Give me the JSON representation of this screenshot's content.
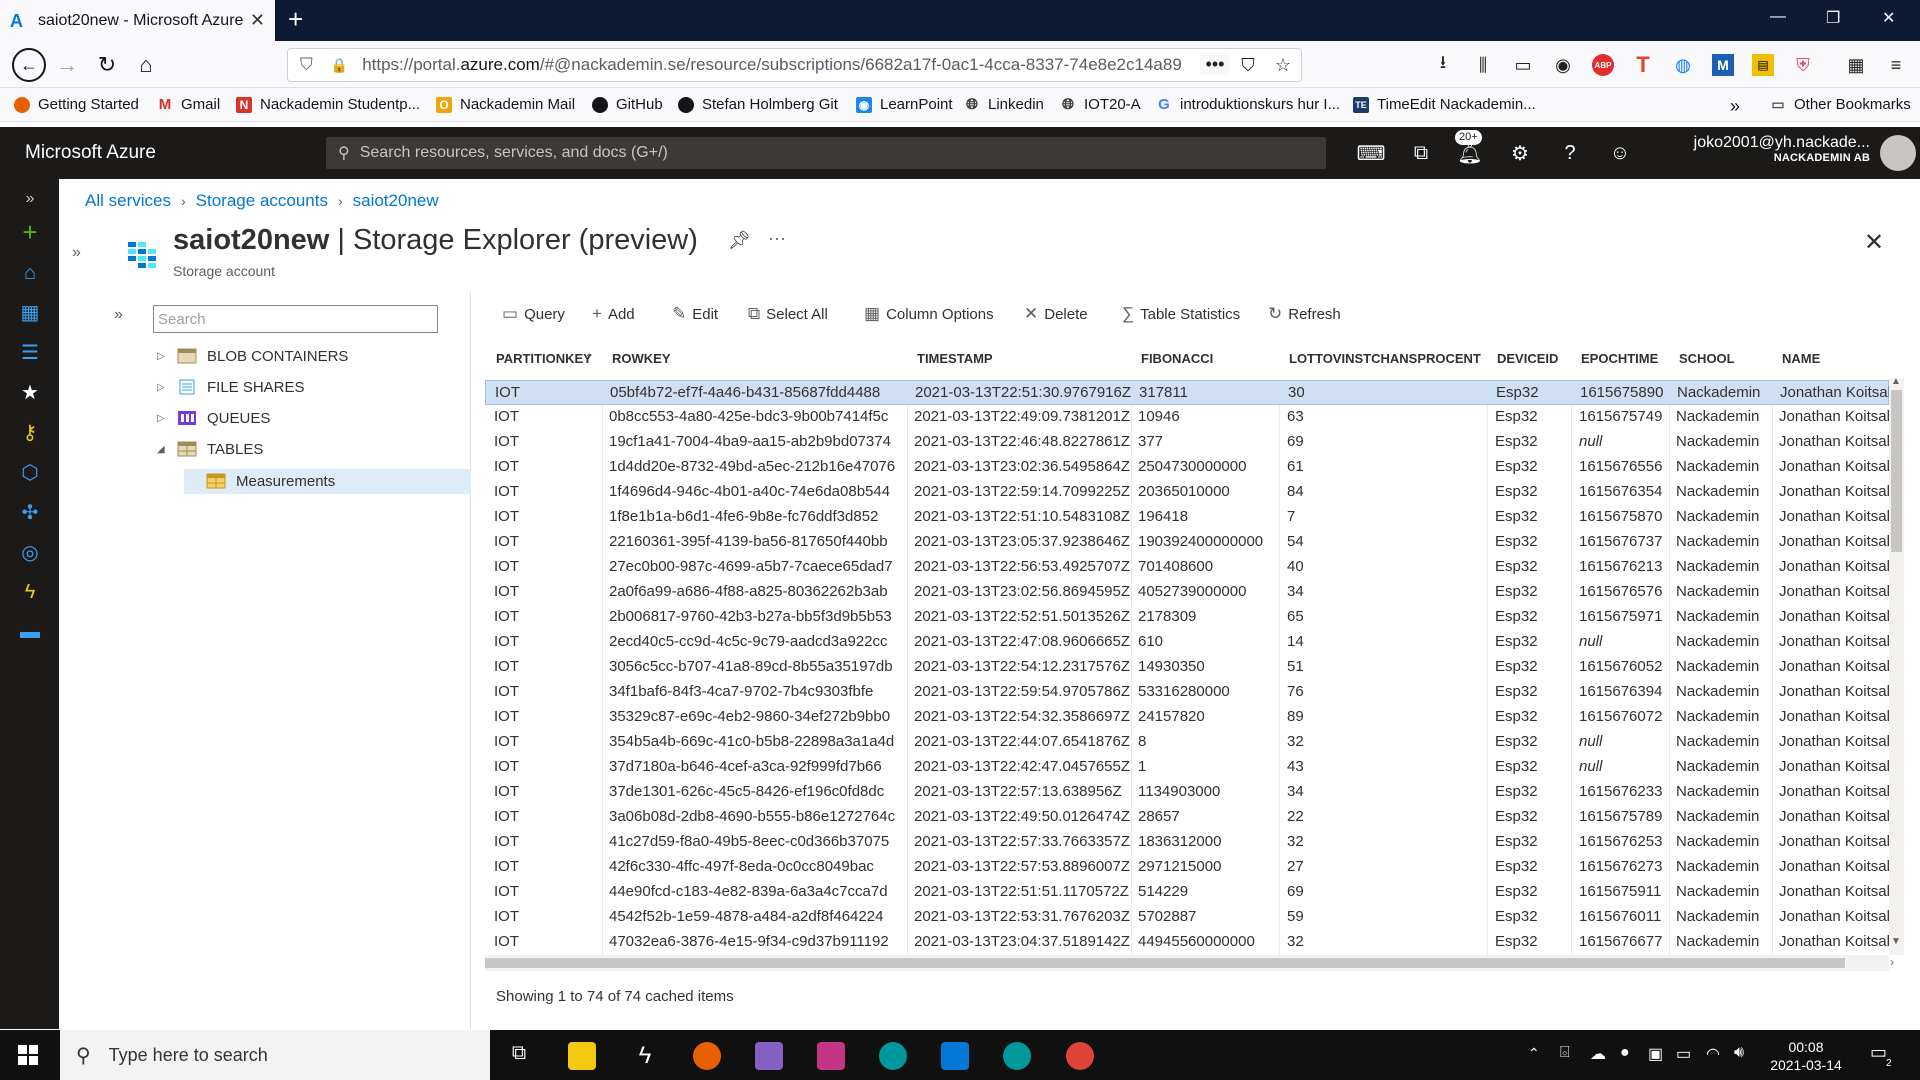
{
  "browser": {
    "tab_title": "saiot20new - Microsoft Azure",
    "url_prefix": "https://portal.",
    "url_host": "azure.com",
    "url_rest": "/#@nackademin.se/resource/subscriptions/6682a17f-0ac1-4cca-8337-74e8e2c14a89",
    "bookmarks": [
      "Getting Started",
      "Gmail",
      "Nackademin Studentp...",
      "Nackademin Mail",
      "GitHub",
      "Stefan Holmberg Git",
      "LearnPoint",
      "Linkedin",
      "IOT20-A",
      "introduktionskurs hur I...",
      "TimeEdit Nackademin...",
      "Other Bookmarks"
    ]
  },
  "azure": {
    "brand": "Microsoft Azure",
    "search_placeholder": "Search resources, services, and docs (G+/)",
    "notifications_badge": "20+",
    "user_email": "joko2001@yh.nackade...",
    "user_org": "NACKADEMIN AB"
  },
  "breadcrumb": [
    "All services",
    "Storage accounts",
    "saiot20new"
  ],
  "page": {
    "title_resource": "saiot20new",
    "title_rest": " | Storage Explorer (preview)",
    "subtitle": "Storage account"
  },
  "tree": {
    "search_placeholder": "Search",
    "items": [
      "BLOB CONTAINERS",
      "FILE SHARES",
      "QUEUES",
      "TABLES",
      "Measurements"
    ]
  },
  "toolbar": [
    "Query",
    "Add",
    "Edit",
    "Select All",
    "Column Options",
    "Delete",
    "Table Statistics",
    "Refresh"
  ],
  "table": {
    "columns": [
      "PARTITIONKEY",
      "ROWKEY",
      "TIMESTAMP",
      "FIBONACCI",
      "LOTTOVINSTCHANSPROCENT",
      "DEVICEID",
      "EPOCHTIME",
      "SCHOOL",
      "NAME"
    ],
    "rows": [
      [
        "IOT",
        "05bf4b72-ef7f-4a46-b431-85687fdd4488",
        "2021-03-13T22:51:30.9767916Z",
        "317811",
        "30",
        "Esp32",
        "1615675890",
        "Nackademin",
        "Jonathan Koitsal"
      ],
      [
        "IOT",
        "0b8cc553-4a80-425e-bdc3-9b00b7414f5c",
        "2021-03-13T22:49:09.7381201Z",
        "10946",
        "63",
        "Esp32",
        "1615675749",
        "Nackademin",
        "Jonathan Koitsal"
      ],
      [
        "IOT",
        "19cf1a41-7004-4ba9-aa15-ab2b9bd07374",
        "2021-03-13T22:46:48.8227861Z",
        "377",
        "69",
        "Esp32",
        "null",
        "Nackademin",
        "Jonathan Koitsal"
      ],
      [
        "IOT",
        "1d4dd20e-8732-49bd-a5ec-212b16e47076",
        "2021-03-13T23:02:36.5495864Z",
        "2504730000000",
        "61",
        "Esp32",
        "1615676556",
        "Nackademin",
        "Jonathan Koitsal"
      ],
      [
        "IOT",
        "1f4696d4-946c-4b01-a40c-74e6da08b544",
        "2021-03-13T22:59:14.7099225Z",
        "20365010000",
        "84",
        "Esp32",
        "1615676354",
        "Nackademin",
        "Jonathan Koitsal"
      ],
      [
        "IOT",
        "1f8e1b1a-b6d1-4fe6-9b8e-fc76ddf3d852",
        "2021-03-13T22:51:10.5483108Z",
        "196418",
        "7",
        "Esp32",
        "1615675870",
        "Nackademin",
        "Jonathan Koitsal"
      ],
      [
        "IOT",
        "22160361-395f-4139-ba56-817650f440bb",
        "2021-03-13T23:05:37.9238646Z",
        "190392400000000",
        "54",
        "Esp32",
        "1615676737",
        "Nackademin",
        "Jonathan Koitsal"
      ],
      [
        "IOT",
        "27ec0b00-987c-4699-a5b7-7caece65dad7",
        "2021-03-13T22:56:53.4925707Z",
        "701408600",
        "40",
        "Esp32",
        "1615676213",
        "Nackademin",
        "Jonathan Koitsal"
      ],
      [
        "IOT",
        "2a0f6a99-a686-4f88-a825-80362262b3ab",
        "2021-03-13T23:02:56.8694595Z",
        "4052739000000",
        "34",
        "Esp32",
        "1615676576",
        "Nackademin",
        "Jonathan Koitsal"
      ],
      [
        "IOT",
        "2b006817-9760-42b3-b27a-bb5f3d9b5b53",
        "2021-03-13T22:52:51.5013526Z",
        "2178309",
        "65",
        "Esp32",
        "1615675971",
        "Nackademin",
        "Jonathan Koitsal"
      ],
      [
        "IOT",
        "2ecd40c5-cc9d-4c5c-9c79-aadcd3a922cc",
        "2021-03-13T22:47:08.9606665Z",
        "610",
        "14",
        "Esp32",
        "null",
        "Nackademin",
        "Jonathan Koitsal"
      ],
      [
        "IOT",
        "3056c5cc-b707-41a8-89cd-8b55a35197db",
        "2021-03-13T22:54:12.2317576Z",
        "14930350",
        "51",
        "Esp32",
        "1615676052",
        "Nackademin",
        "Jonathan Koitsal"
      ],
      [
        "IOT",
        "34f1baf6-84f3-4ca7-9702-7b4c9303fbfe",
        "2021-03-13T22:59:54.9705786Z",
        "53316280000",
        "76",
        "Esp32",
        "1615676394",
        "Nackademin",
        "Jonathan Koitsal"
      ],
      [
        "IOT",
        "35329c87-e69c-4eb2-9860-34ef272b9bb0",
        "2021-03-13T22:54:32.3586697Z",
        "24157820",
        "89",
        "Esp32",
        "1615676072",
        "Nackademin",
        "Jonathan Koitsal"
      ],
      [
        "IOT",
        "354b5a4b-669c-41c0-b5b8-22898a3a1a4d",
        "2021-03-13T22:44:07.6541876Z",
        "8",
        "32",
        "Esp32",
        "null",
        "Nackademin",
        "Jonathan Koitsal"
      ],
      [
        "IOT",
        "37d7180a-b646-4cef-a3ca-92f999fd7b66",
        "2021-03-13T22:42:47.0457655Z",
        "1",
        "43",
        "Esp32",
        "null",
        "Nackademin",
        "Jonathan Koitsal"
      ],
      [
        "IOT",
        "37de1301-626c-45c5-8426-ef196c0fd8dc",
        "2021-03-13T22:57:13.638956Z",
        "1134903000",
        "34",
        "Esp32",
        "1615676233",
        "Nackademin",
        "Jonathan Koitsal"
      ],
      [
        "IOT",
        "3a06b08d-2db8-4690-b555-b86e1272764c",
        "2021-03-13T22:49:50.0126474Z",
        "28657",
        "22",
        "Esp32",
        "1615675789",
        "Nackademin",
        "Jonathan Koitsal"
      ],
      [
        "IOT",
        "41c27d59-f8a0-49b5-8eec-c0d366b37075",
        "2021-03-13T22:57:33.7663357Z",
        "1836312000",
        "32",
        "Esp32",
        "1615676253",
        "Nackademin",
        "Jonathan Koitsal"
      ],
      [
        "IOT",
        "42f6c330-4ffc-497f-8eda-0c0cc8049bac",
        "2021-03-13T22:57:53.8896007Z",
        "2971215000",
        "27",
        "Esp32",
        "1615676273",
        "Nackademin",
        "Jonathan Koitsal"
      ],
      [
        "IOT",
        "44e90fcd-c183-4e82-839a-6a3a4c7cca7d",
        "2021-03-13T22:51:51.1170572Z",
        "514229",
        "69",
        "Esp32",
        "1615675911",
        "Nackademin",
        "Jonathan Koitsal"
      ],
      [
        "IOT",
        "4542f52b-1e59-4878-a484-a2df8f464224",
        "2021-03-13T22:53:31.7676203Z",
        "5702887",
        "59",
        "Esp32",
        "1615676011",
        "Nackademin",
        "Jonathan Koitsal"
      ],
      [
        "IOT",
        "47032ea6-3876-4e15-9f34-c9d37b911192",
        "2021-03-13T23:04:37.5189142Z",
        "44945560000000",
        "32",
        "Esp32",
        "1615676677",
        "Nackademin",
        "Jonathan Koitsal"
      ]
    ],
    "status": "Showing 1 to 74 of 74 cached items"
  },
  "taskbar": {
    "search_placeholder": "Type here to search",
    "time": "00:08",
    "date": "2021-03-14",
    "notif_count": "2"
  }
}
